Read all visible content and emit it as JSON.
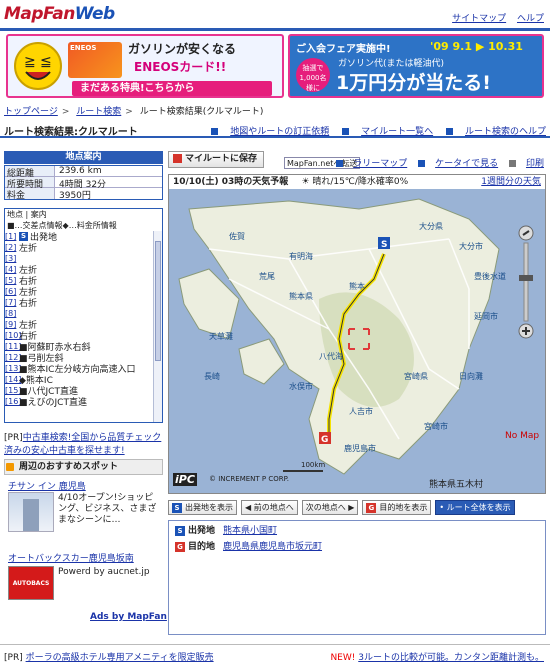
{
  "header": {
    "logo_main": "MapFan",
    "logo_web": "Web",
    "links": [
      "サイトマップ",
      "ヘルプ"
    ]
  },
  "banner_left": {
    "card_label": "ENEOS",
    "line1": "ガソリンが安くなる",
    "line2": "ENEOSカード!!",
    "button": "まだある特典!こちらから"
  },
  "banner_right": {
    "line1": "ご入会フェア実施中!",
    "dates": "'09 9.1 ▶ 10.31",
    "circle": "抽選で1,000名様に",
    "line2": "ガソリン代(または軽油代)",
    "line3": "1万円分が当たる!"
  },
  "breadcrumb": [
    "トップページ",
    "ルート検索",
    "ルート検索結果(クルマルート)"
  ],
  "page": {
    "title": "ルート検索結果:クルマルート",
    "links": [
      "地図やルートの訂正依頼",
      "マイルート一覧へ",
      "ルート検索のヘルプ"
    ]
  },
  "info": {
    "header": "地点案内",
    "rows": [
      {
        "k": "総距離",
        "v": "239.6 km"
      },
      {
        "k": "所要時間",
        "v": "4時間 32分"
      },
      {
        "k": "料金",
        "v": "3950円"
      }
    ]
  },
  "guide": {
    "cols": "地点 | 案内",
    "legend": "■…交差点情報◆…料金所情報",
    "steps": [
      {
        "n": "[1]",
        "t": "出発地",
        "icon": "S"
      },
      {
        "n": "[2]",
        "t": "左折"
      },
      {
        "n": "[3]",
        "t": ""
      },
      {
        "n": "[4]",
        "t": "左折"
      },
      {
        "n": "[5]",
        "t": "右折"
      },
      {
        "n": "[6]",
        "t": "左折"
      },
      {
        "n": "[7]",
        "t": "右折"
      },
      {
        "n": "[8]",
        "t": ""
      },
      {
        "n": "[9]",
        "t": "左折"
      },
      {
        "n": "[10]",
        "t": "右折"
      },
      {
        "n": "[11]",
        "t": "■阿蘇町赤水右斜"
      },
      {
        "n": "[12]",
        "t": "■弓削左斜"
      },
      {
        "n": "[13]",
        "t": "■熊本IC左分岐方向高速入口"
      },
      {
        "n": "[14]",
        "t": "◆熊本IC"
      },
      {
        "n": "[15]",
        "t": "■八代JCT直進"
      },
      {
        "n": "[16]",
        "t": "■えびのJCT直進"
      }
    ]
  },
  "pr1": {
    "tag": "[PR]",
    "text": "中古車検索!全国から品質チェック済みの安心中古車を探せます!"
  },
  "spots": {
    "header": "周辺のおすすめスポット",
    "s1_title": "チサン イン 鹿児島",
    "s1_desc": "4/10オープン!ショッピング、ビジネス、さまざまなシーンに…",
    "s2_title": "オートバックスカー鹿児島坂南",
    "s2_img": "AUTOBACS",
    "s2_desc": "Powerd by aucnet.jp",
    "ads": "Ads by MapFan"
  },
  "toolbar": {
    "save": "マイルートに保存",
    "mfnet": "MapFan.netへ転送",
    "tools": [
      "ラリーマップ",
      "ケータイで見る",
      "印刷"
    ]
  },
  "weather": {
    "date": "10/10(土) 03時の天気予報",
    "forecast": "晴れ/15℃/降水確率0%",
    "weekly": "1週間分の天気"
  },
  "map": {
    "labels": [
      "天草灘",
      "有明海",
      "八代海",
      "大分県",
      "宮崎県",
      "熊本県",
      "日向灘",
      "豊後水道",
      "鹿児島市",
      "熊本",
      "長崎",
      "佐賀",
      "荒尾",
      "大分市",
      "宮崎市",
      "延岡市",
      "人吉市",
      "水俣市"
    ],
    "nomap": "No Map",
    "ipc": "iPC",
    "copyright": "© INCREMENT P CORP.",
    "scale": "100km",
    "city": "熊本県五木村"
  },
  "nav": [
    "出発地を表示",
    "前の地点へ",
    "次の地点へ",
    "目的地を表示",
    "ルート全体を表示"
  ],
  "od": {
    "origin_label": "出発地",
    "origin": "熊本県小国町",
    "dest_label": "目的地",
    "dest": "鹿児島県鹿児島市坂元町"
  },
  "footer": {
    "pr_tag": "[PR]",
    "pr_text": "ポーラの高級ホテル専用アメニティを限定販売",
    "new": "NEW!",
    "right": "3ルートの比較が可能。カンタン距離計測も。"
  }
}
